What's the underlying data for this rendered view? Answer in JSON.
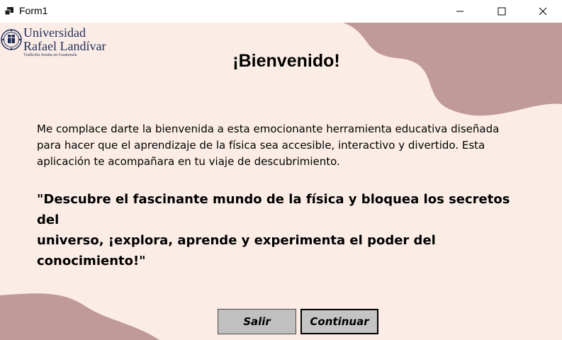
{
  "window": {
    "title": "Form1",
    "minimize_icon": "minimize-icon",
    "maximize_icon": "maximize-icon",
    "close_icon": "close-icon"
  },
  "logo": {
    "line1": "Universidad",
    "line2": "Rafael Landívar",
    "tagline": "Tradición Jesuita en Guatemala",
    "seal_icon": "university-seal-icon"
  },
  "content": {
    "heading": "¡Bienvenido!",
    "intro_lines": [
      "Me complace darte la bienvenida a esta emocionante herramienta educativa diseñada",
      "para hacer que el aprendizaje de la física sea accesible, interactivo y divertido. Esta",
      "aplicación te acompañara en tu viaje de descubrimiento."
    ],
    "quote_lines": [
      "\"Descubre el fascinante mundo de la física y bloquea los secretos del",
      "universo, ¡explora, aprende y experimenta el poder del conocimiento!\""
    ]
  },
  "buttons": {
    "exit_label": "Salir",
    "continue_label": "Continuar"
  },
  "colors": {
    "background": "#fbede6",
    "accent_blob": "#c09a98",
    "logo_blue": "#1f2d5a",
    "button_gray": "#c0c0c0"
  }
}
